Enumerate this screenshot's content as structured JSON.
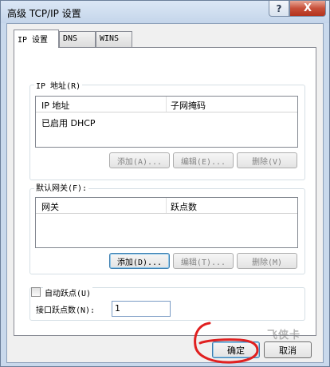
{
  "window": {
    "title": "高级 TCP/IP 设置",
    "help_glyph": "?",
    "close_glyph": "X"
  },
  "tabs": [
    {
      "label": "IP 设置",
      "active": true
    },
    {
      "label": "DNS",
      "active": false
    },
    {
      "label": "WINS",
      "active": false
    }
  ],
  "ip_group": {
    "label": "IP 地址(R)",
    "columns": [
      "IP 地址",
      "子网掩码"
    ],
    "rows": [
      [
        "已启用 DHCP",
        ""
      ]
    ],
    "buttons": [
      "添加(A)...",
      "编辑(E)...",
      "删除(V)"
    ]
  },
  "gateway_group": {
    "label": "默认网关(F):",
    "columns": [
      "网关",
      "跃点数"
    ],
    "rows": [],
    "buttons": [
      "添加(D)...",
      "编辑(T)...",
      "删除(M)"
    ]
  },
  "metric": {
    "auto_label": "自动跃点(U)",
    "auto_checked": false,
    "interface_label": "接口跃点数(N):",
    "interface_value": "1"
  },
  "footer": {
    "ok_label": "确定",
    "cancel_label": "取消"
  },
  "annotation": {
    "color": "#e02020"
  },
  "watermark": {
    "text": "飞侠卡"
  }
}
